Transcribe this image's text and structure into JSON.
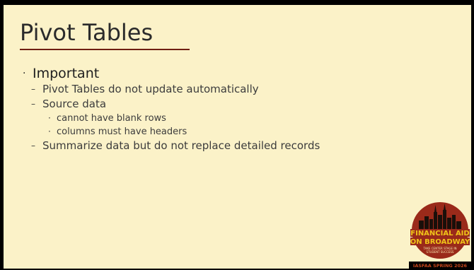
{
  "slide": {
    "title": "Pivot Tables",
    "bullet_marker": "·",
    "dash_marker": "–",
    "heading": "Important",
    "items": [
      "Pivot Tables do not update automatically",
      "Source data",
      "Summarize data but do not replace detailed records"
    ],
    "source_data_subitems": [
      "cannot have blank rows",
      "columns must have headers"
    ]
  },
  "logo": {
    "line1": "FINANCIAL AID",
    "line2": "ON BROADWAY",
    "tagline1": "TAKE CENTER STAGE IN",
    "tagline2": "STUDENT SUCCESS",
    "footer": "IASFAA SPRING 2026"
  },
  "colors": {
    "background": "#fbf2c8",
    "frame": "#000000",
    "title_rule": "#6f1f12",
    "logo_red": "#9a2a1a",
    "logo_gold": "#f0c419"
  }
}
